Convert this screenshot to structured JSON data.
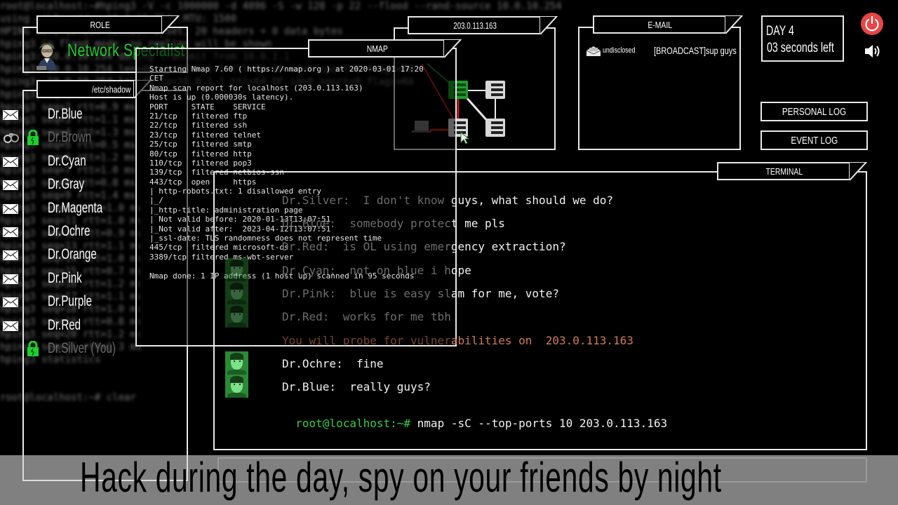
{
  "background_terminal": {
    "lines": [
      "root@localhost:~#hping3 -V -c 1000000 -d 4096 -S -w 128 -p 22 --flood --rand-source 10.0.10.254",
      "using eth0, addr: 10.0.10.254, MTU: 1500",
      "HPING 10.0.10.254 (eth0): S set, 20 headers + 0 data bytes",
      "hping3 in flood mode, no replies will be shown",
      "hping3: 10.0.10.254 during transmit from 10.0.1.1",
      "hping3: 10.0.10.254 len=46 ip=10.0.1.1 ttl=64 DF id=0 sport=0 flags=RA",
      "hping3: 10.0.10.254 len=46 ip=10.0.1.1 ttl=64 DF id=0 sport=0 flags=RA",
      "hping3 seq=1 rtt=1.7 ms",
      "hping3 seq=2 rtt=0.9 ms",
      "hping3 seq=3 rtt=1.1 ms",
      "hping3 seq=4 rtt=1.3 ms",
      "hping3 seq=5 rtt=0.5 ms",
      "hping3 seq=6 rtt=1.2 ms",
      "hping3 seq=7 rtt=1.0 ms",
      "hping3 seq=8 rtt=0.8 ms",
      "hping3 seq=9 rtt=1.4 ms",
      "hping3 seq=10 rtt=1.0 ms",
      "hping3 seq=11 rtt=1.0 ms",
      "hping3 seq=12 rtt=0.9 ms",
      "hping3 seq=13 rtt=1.1 ms",
      "hping3 seq=14 rtt=1.0 ms",
      "hping3 seq=15 rtt=0.7 ms",
      "hping3 seq=16 rtt=1.2 ms",
      "hping3 seq=17 rtt=1.1 ms",
      "hping3 seq=18 rtt=1.0 ms",
      "hping3 seq=19 rtt=0.8 ms",
      "hping3 seq=20 rtt=1.2 ms",
      "hping3 seq=21 rtt=1.3 ms",
      "hping3 statistics",
      "",
      "",
      "root@localhost:~# clear"
    ]
  },
  "role": {
    "tab_label": "ROLE",
    "title": "Network Specialist"
  },
  "shadow": {
    "tab_label": "/etc/shadow",
    "users": [
      {
        "name": "Dr.Blue",
        "status": "mail"
      },
      {
        "name": "Dr.Brown",
        "status": "arrested"
      },
      {
        "name": "Dr.Cyan",
        "status": "mail"
      },
      {
        "name": "Dr.Gray",
        "status": "mail"
      },
      {
        "name": "Dr.Magenta",
        "status": "mail"
      },
      {
        "name": "Dr.Ochre",
        "status": "mail"
      },
      {
        "name": "Dr.Orange",
        "status": "mail"
      },
      {
        "name": "Dr.Pink",
        "status": "mail"
      },
      {
        "name": "Dr.Purple",
        "status": "mail"
      },
      {
        "name": "Dr.Red",
        "status": "mail"
      },
      {
        "name": "Dr.Silver (You)",
        "status": "self"
      }
    ]
  },
  "nmap": {
    "tab_label": "NMAP",
    "output": [
      "Starting Nmap 7.60 ( https://nmap.org ) at 2020-03-01 17:20",
      "CET",
      "Nmap scan report for localhost (203.0.113.163)",
      "Host is up (0.000030s latency).",
      "PORT     STATE    SERVICE",
      "21/tcp   filtered ftp",
      "22/tcp   filtered ssh",
      "23/tcp   filtered telnet",
      "25/tcp   filtered smtp",
      "80/tcp   filtered http",
      "110/tcp  filtered pop3",
      "139/tcp  filtered netbios-ssn",
      "443/tcp  open     https",
      "| http-robots.txt: 1 disallowed entry",
      "|_/",
      "|_http-title: administration page",
      "| Not valid before: 2020-01-13T13:07:51",
      "|_Not valid after:  2023-04-12T13:07:51",
      "|_ssl-date: TLS randomness does not represent time",
      "445/tcp  filtered microsoft-ds",
      "3389/tcp filtered ms-wbt-server",
      "",
      "Nmap done: 1 IP address (1 host up) scanned in 95 seconds"
    ]
  },
  "network": {
    "tab_label": "203.0.113.163",
    "colors": {
      "active": "#1e9b2a",
      "attack": "#b52020",
      "node": "#d8d8d8"
    }
  },
  "email": {
    "tab_label": "E-MAIL",
    "messages": [
      {
        "from": "undisclosed",
        "subject": "[BROADCAST]sup guys"
      }
    ]
  },
  "day": {
    "label": "DAY 4",
    "time_left": "03 seconds left"
  },
  "buttons": {
    "personal_log": "PERSONAL LOG",
    "event_log": "EVENT LOG"
  },
  "terminal": {
    "tab_label": "TERMINAL",
    "lines": [
      {
        "type": "chat",
        "dim_prefix": "Dr.Silver:  I don't know ",
        "text": "guys, what should we do?",
        "face": false
      },
      {
        "type": "chat",
        "dim_prefix": "Dr.Blue:  somebody protec",
        "text": "t me pls",
        "face": false
      },
      {
        "type": "chat",
        "dim_prefix": "Dr.Red:  is OL using emer",
        "text": "gency extraction?",
        "face": false
      },
      {
        "type": "chat",
        "dim_prefix": "Dr.Cyan:  not on blue i h",
        "text": "ope",
        "face": true
      },
      {
        "type": "chat",
        "dim_prefix": "Dr.Pink:  blue is easy sl",
        "text": "am for me, vote?",
        "face": true
      },
      {
        "type": "chat",
        "dim_prefix": "Dr.Red:  works for me tbh",
        "text": "",
        "face": true
      },
      {
        "type": "system",
        "dim_prefix": "You will probe for vulner",
        "text": "abilities on  203.0.113.163",
        "face": false
      },
      {
        "type": "chat",
        "dim_prefix": "",
        "text": "Dr.Ochre:  fine",
        "face": true
      },
      {
        "type": "chat",
        "dim_prefix": "",
        "text": "Dr.Blue:  really guys?",
        "face": true
      }
    ],
    "prompt": "root@localhost:~#",
    "command": " nmap -sC --top-ports 10 203.0.113.163"
  },
  "caption": {
    "text": "Hack during the day, spy on your friends by night"
  },
  "colors": {
    "accent_green": "#1fcf2e",
    "power_red": "#e84545",
    "system_orange": "#d07a5a",
    "caption_bg": "#808080"
  }
}
